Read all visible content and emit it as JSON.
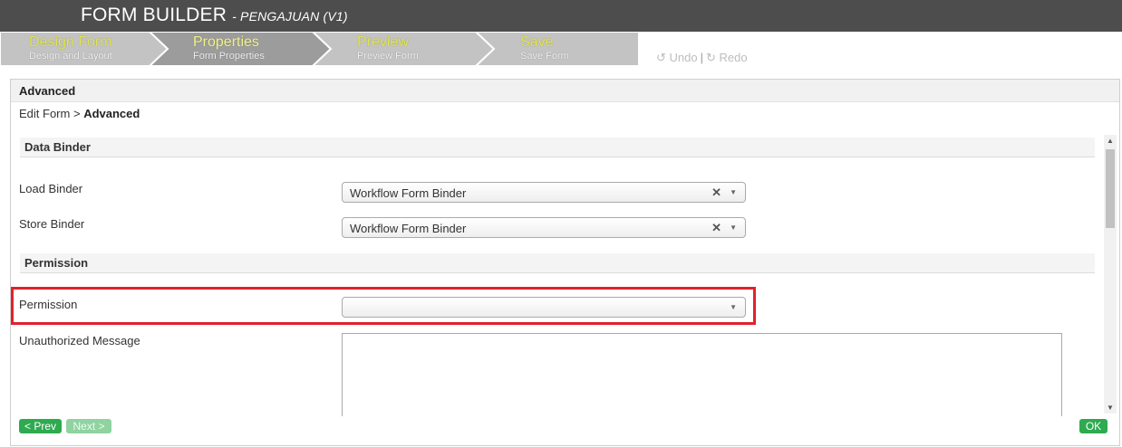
{
  "header": {
    "title": "FORM BUILDER",
    "subtitle": "- PENGAJUAN (V1)"
  },
  "steps": [
    {
      "label": "Design Form",
      "sub": "Design and Layout"
    },
    {
      "label": "Properties",
      "sub": "Form Properties"
    },
    {
      "label": "Preview",
      "sub": "Preview Form"
    },
    {
      "label": "Save",
      "sub": "Save Form"
    }
  ],
  "toolbar": {
    "undo": "Undo",
    "separator": "|",
    "redo": "Redo"
  },
  "panel": {
    "title": "Advanced",
    "breadcrumb_parent": "Edit Form",
    "breadcrumb_sep": ">",
    "breadcrumb_current": "Advanced"
  },
  "sections": {
    "data_binder": "Data Binder",
    "permission": "Permission"
  },
  "fields": {
    "load_binder": {
      "label": "Load Binder",
      "value": "Workflow Form Binder"
    },
    "store_binder": {
      "label": "Store Binder",
      "value": "Workflow Form Binder"
    },
    "permission": {
      "label": "Permission",
      "value": ""
    },
    "unauthorized_message": {
      "label": "Unauthorized Message",
      "value": ""
    }
  },
  "buttons": {
    "prev": "< Prev",
    "next": "Next >",
    "ok": "OK"
  },
  "colors": {
    "highlight": "#e0222c",
    "button_green": "#2eaa4f",
    "header_bg": "#4d4d4d"
  }
}
